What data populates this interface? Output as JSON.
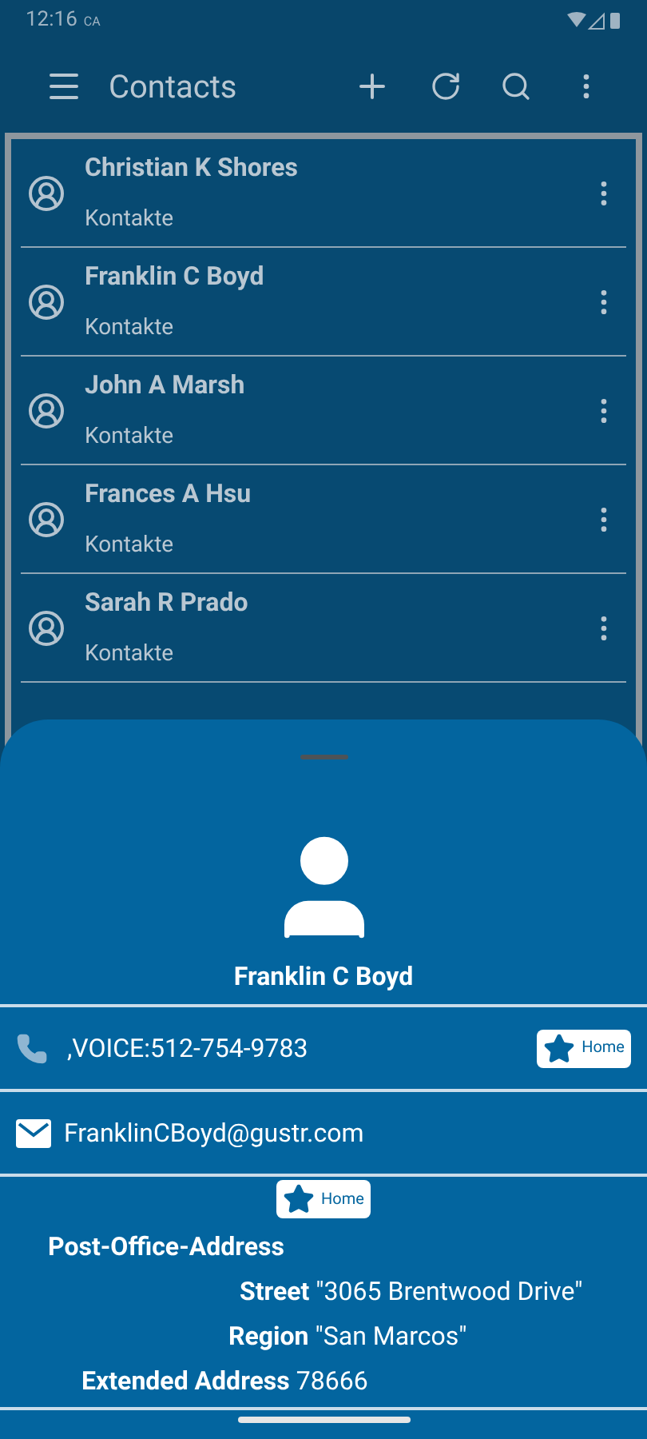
{
  "status_bar": {
    "time": "12:16",
    "carrier": "CA"
  },
  "app_bar": {
    "title": "Contacts"
  },
  "contacts": [
    {
      "name": "Christian K Shores",
      "account": "Kontakte"
    },
    {
      "name": "Franklin C Boyd",
      "account": "Kontakte"
    },
    {
      "name": "John A Marsh",
      "account": "Kontakte"
    },
    {
      "name": "Frances A Hsu",
      "account": "Kontakte"
    },
    {
      "name": "Sarah R Prado",
      "account": "Kontakte"
    }
  ],
  "detail": {
    "name": "Franklin C Boyd",
    "phone": {
      "value": ",VOICE:512-754-9783",
      "tag": "Home"
    },
    "email": {
      "value": "FranklinCBoyd@gustr.com"
    },
    "address": {
      "tag": "Home",
      "type": "Post-Office-Address",
      "fields": [
        {
          "label": "Street",
          "value": "\"3065 Brentwood Drive\""
        },
        {
          "label": "Region",
          "value": "\"San Marcos\""
        },
        {
          "label": "Extended Address",
          "value": "78666"
        }
      ]
    }
  }
}
